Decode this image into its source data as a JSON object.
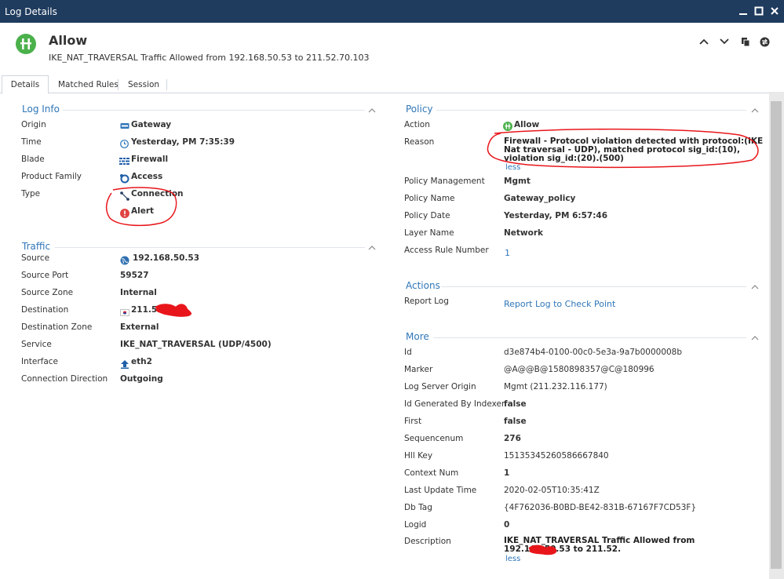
{
  "window": {
    "title": "Log Details"
  },
  "header": {
    "title": "Allow",
    "subtitle": "IKE_NAT_TRAVERSAL Traffic Allowed from 192.168.50.53 to 211.52.70.103"
  },
  "tabs": [
    "Details",
    "Matched Rules",
    "Session"
  ],
  "log_info": {
    "title": "Log Info",
    "rows": [
      {
        "label": "Origin",
        "value": "Gateway"
      },
      {
        "label": "Time",
        "value": "Yesterday, PM 7:35:39"
      },
      {
        "label": "Blade",
        "value": "Firewall"
      },
      {
        "label": "Product Family",
        "value": "Access"
      },
      {
        "label": "Type",
        "value": "Connection",
        "value2": "Alert"
      }
    ]
  },
  "traffic": {
    "title": "Traffic",
    "rows": [
      {
        "label": "Source",
        "value": "192.168.50.53"
      },
      {
        "label": "Source Port",
        "value": "59527"
      },
      {
        "label": "Source Zone",
        "value": "Internal"
      },
      {
        "label": "Destination",
        "value": "211.52"
      },
      {
        "label": "Destination Zone",
        "value": "External"
      },
      {
        "label": "Service",
        "value": "IKE_NAT_TRAVERSAL (UDP/4500)"
      },
      {
        "label": "Interface",
        "value": "eth2"
      },
      {
        "label": "Connection Direction",
        "value": "Outgoing"
      }
    ]
  },
  "policy": {
    "title": "Policy",
    "action_label": "Action",
    "action_value": "Allow",
    "reason_label": "Reason",
    "reason_value": "Firewall  -  Protocol violation detected with protocol:(IKE Nat traversal - UDP), matched protocol sig_id:(10), violation sig_id:(20).(500)",
    "less": "less",
    "rows": [
      {
        "label": "Policy Management",
        "value": "Mgmt"
      },
      {
        "label": "Policy Name",
        "value": "Gateway_policy"
      },
      {
        "label": "Policy Date",
        "value": "Yesterday, PM 6:57:46"
      },
      {
        "label": "Layer Name",
        "value": "Network"
      },
      {
        "label": "Access Rule Number",
        "value": "1"
      }
    ]
  },
  "actions": {
    "title": "Actions",
    "report_label": "Report Log",
    "report_link": "Report Log to Check Point"
  },
  "more": {
    "title": "More",
    "rows": [
      {
        "label": "Id",
        "value": "d3e874b4-0100-00c0-5e3a-9a7b0000008b"
      },
      {
        "label": "Marker",
        "value": "@A@@B@1580898357@C@180996"
      },
      {
        "label": "Log Server Origin",
        "value": "Mgmt (211.232.116.177)"
      },
      {
        "label": "Id Generated By Indexer",
        "value": "false"
      },
      {
        "label": "First",
        "value": "false"
      },
      {
        "label": "Sequencenum",
        "value": "276"
      },
      {
        "label": "Hll Key",
        "value": "15135345260586667840"
      },
      {
        "label": "Context Num",
        "value": "1"
      },
      {
        "label": "Last Update Time",
        "value": "2020-02-05T10:35:41Z"
      },
      {
        "label": "Db Tag",
        "value": "{4F762036-B0BD-BE42-831B-67167F7CD53F}"
      },
      {
        "label": "Logid",
        "value": "0"
      }
    ],
    "description_label": "Description",
    "description_value": "IKE_NAT_TRAVERSAL Traffic Allowed from 192.168.50.53 to 211.52.",
    "less": "less"
  },
  "colors": {
    "titlebar": "#1f3b5e",
    "accent": "#2f76b8",
    "allow_green": "#4bb14b",
    "alert_red": "#e04343",
    "annotation_red": "#e8161b"
  }
}
